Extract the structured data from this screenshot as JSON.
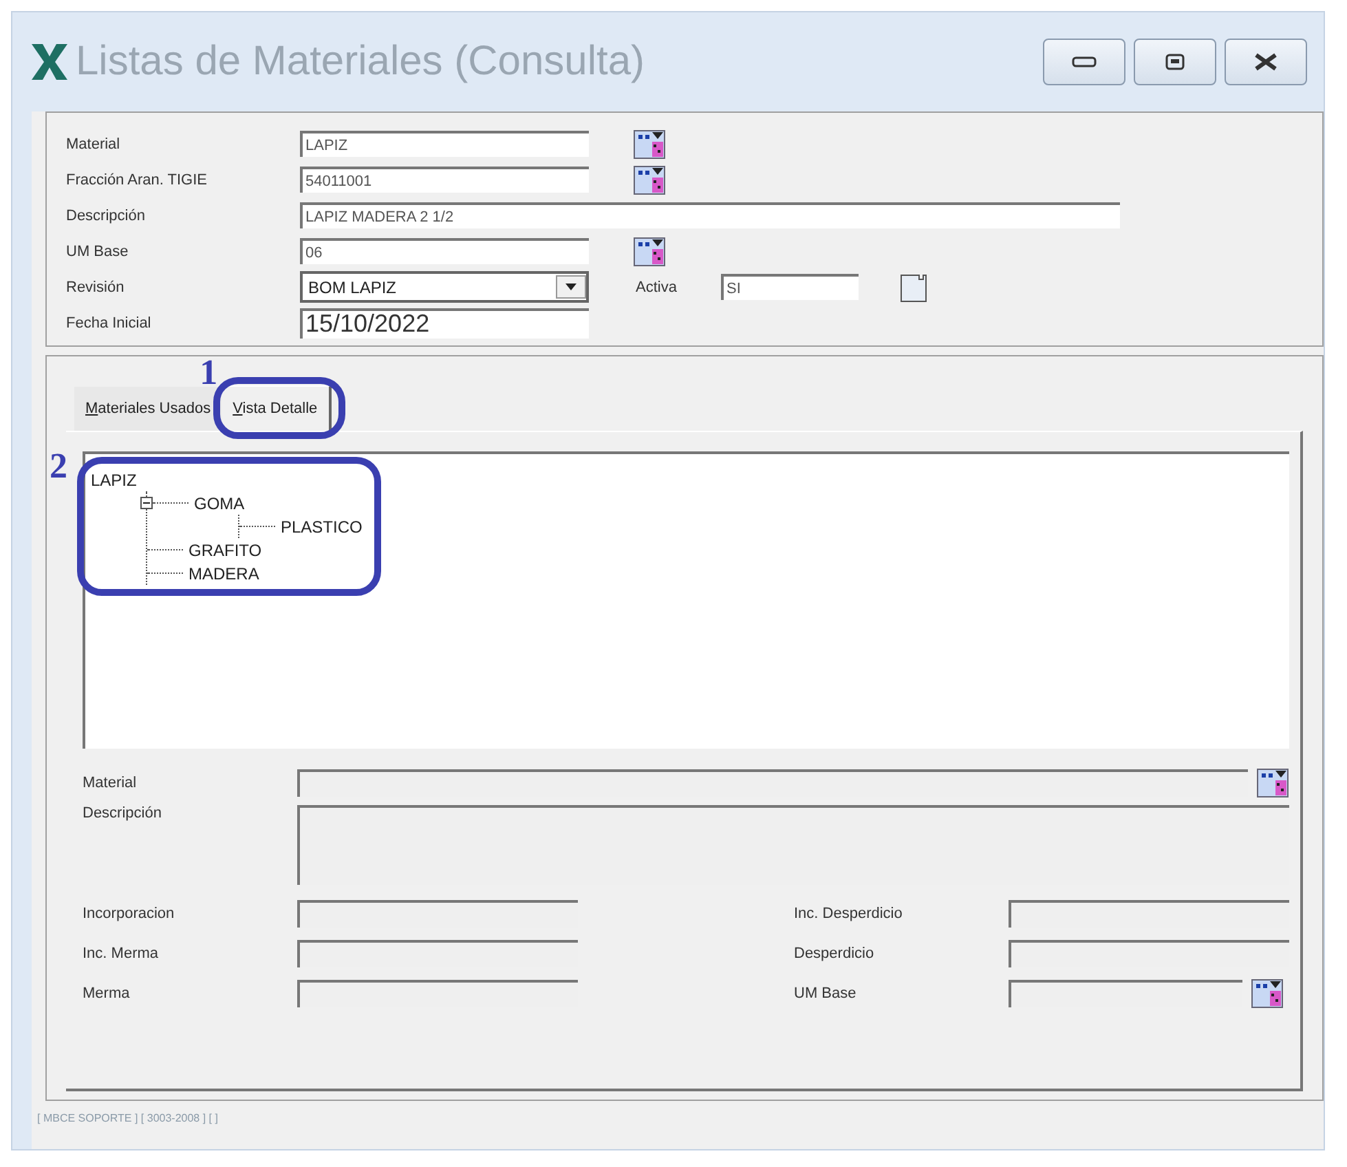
{
  "window": {
    "title": "Listas de Materiales (Consulta)"
  },
  "header_fields": [
    {
      "label": "Material",
      "value": "LAPIZ",
      "kind": "picker"
    },
    {
      "label": "Fracción Aran. TIGIE",
      "value": "54011001",
      "kind": "picker"
    },
    {
      "label": "Descripción",
      "value": "LAPIZ MADERA 2 1/2",
      "kind": "wide"
    },
    {
      "label": "UM Base",
      "value": "06",
      "kind": "picker"
    },
    {
      "label": "Revisión",
      "value": "BOM LAPIZ",
      "kind": "combo",
      "extra_label": "Activa",
      "extra_value": "SI"
    },
    {
      "label": "Fecha Inicial",
      "value": "15/10/2022",
      "kind": "date"
    }
  ],
  "tabs": [
    {
      "label": "Materiales Usados",
      "selected": false
    },
    {
      "label": "Vista Detalle",
      "selected": true
    }
  ],
  "tree": {
    "label": "LAPIZ",
    "expanded": true,
    "children": [
      {
        "label": "GOMA",
        "expanded": true,
        "children": [
          {
            "label": "PLASTICO"
          }
        ]
      },
      {
        "label": "GRAFITO"
      },
      {
        "label": "MADERA"
      }
    ]
  },
  "detail": {
    "material_label": "Material",
    "description_label": "Descripción",
    "left_fields": [
      {
        "label": "Incorporacion"
      },
      {
        "label": "Inc. Merma"
      },
      {
        "label": "Merma"
      }
    ],
    "right_fields": [
      {
        "label": "Inc. Desperdicio",
        "picker": false
      },
      {
        "label": "Desperdicio",
        "picker": false
      },
      {
        "label": "UM Base",
        "picker": true
      }
    ]
  },
  "annotations": [
    "1",
    "2"
  ],
  "status_bar": "[ MBCE SOPORTE ]  [ 3003-2008 ]  [  ]"
}
